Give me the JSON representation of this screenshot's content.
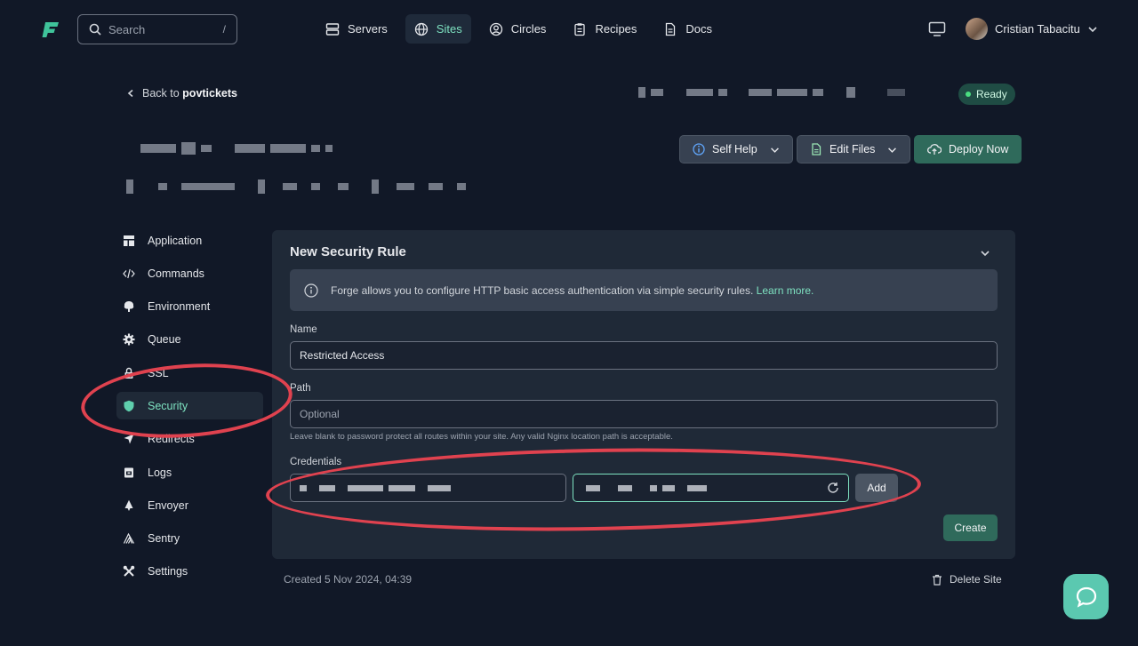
{
  "topbar": {
    "search_placeholder": "Search",
    "search_shortcut": "/",
    "nav": [
      {
        "label": "Servers",
        "icon": "server-icon"
      },
      {
        "label": "Sites",
        "icon": "globe-icon",
        "active": true
      },
      {
        "label": "Circles",
        "icon": "user-circle-icon"
      },
      {
        "label": "Recipes",
        "icon": "clipboard-icon"
      },
      {
        "label": "Docs",
        "icon": "document-icon"
      }
    ],
    "user_name": "Cristian Tabacitu"
  },
  "header": {
    "back_prefix": "Back to",
    "back_target": "povtickets",
    "status": "Ready",
    "actions": {
      "self_help": "Self Help",
      "edit_files": "Edit Files",
      "deploy_now": "Deploy Now"
    }
  },
  "sidebar": {
    "items": [
      {
        "label": "Application",
        "icon": "layout-icon"
      },
      {
        "label": "Commands",
        "icon": "code-icon"
      },
      {
        "label": "Environment",
        "icon": "tree-icon"
      },
      {
        "label": "Queue",
        "icon": "gear-icon"
      },
      {
        "label": "SSL",
        "icon": "lock-icon"
      },
      {
        "label": "Security",
        "icon": "shield-icon",
        "active": true
      },
      {
        "label": "Redirects",
        "icon": "arrow-icon"
      },
      {
        "label": "Logs",
        "icon": "archive-icon"
      },
      {
        "label": "Envoyer",
        "icon": "envoyer-icon"
      },
      {
        "label": "Sentry",
        "icon": "sentry-icon"
      },
      {
        "label": "Settings",
        "icon": "tools-icon"
      }
    ]
  },
  "panel": {
    "title": "New Security Rule",
    "info_text": "Forge allows you to configure HTTP basic access authentication via simple security rules.",
    "info_link": "Learn more.",
    "name_label": "Name",
    "name_value": "Restricted Access",
    "path_label": "Path",
    "path_placeholder": "Optional",
    "path_help": "Leave blank to password protect all routes within your site. Any valid Nginx location path is acceptable.",
    "credentials_label": "Credentials",
    "add_label": "Add",
    "create_label": "Create"
  },
  "footer": {
    "created": "Created 5 Nov 2024, 04:39",
    "delete": "Delete Site"
  },
  "colors": {
    "background": "#111827",
    "panel": "#1f2937",
    "accent": "#7ee2c1",
    "primary_button": "#2f6a5b",
    "annotation": "#e0424f"
  }
}
